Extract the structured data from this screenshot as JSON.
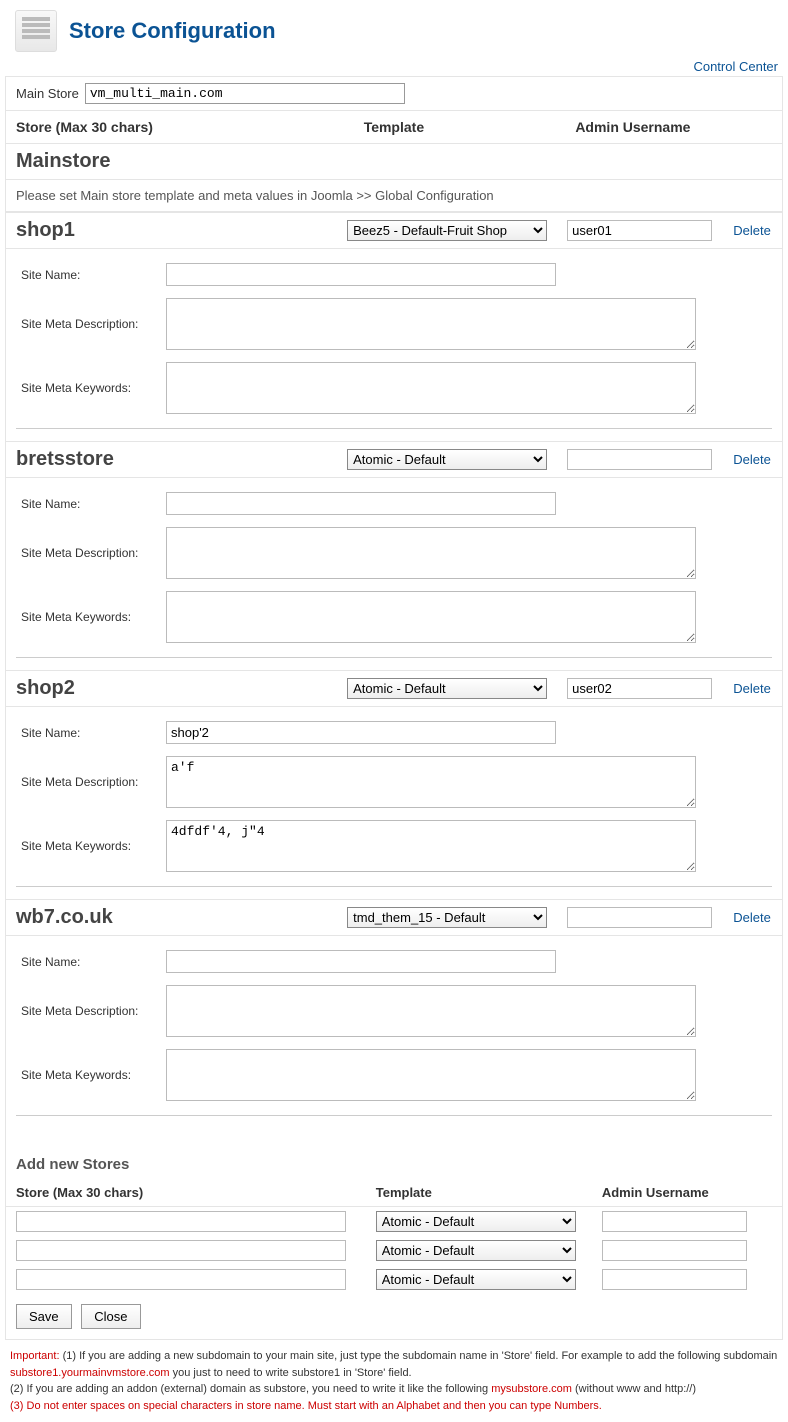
{
  "page_title": "Store Configuration",
  "control_center_link": "Control Center",
  "main_store_label": "Main Store",
  "main_store_value": "vm_multi_main.com",
  "columns": {
    "store": "Store (Max 30 chars)",
    "template": "Template",
    "admin": "Admin Username"
  },
  "mainstore_name": "Mainstore",
  "mainstore_info": "Please set Main store template and meta values in Joomla >> Global Configuration",
  "labels": {
    "site_name": "Site Name:",
    "site_meta_desc": "Site Meta Description:",
    "site_meta_keywords": "Site Meta Keywords:",
    "delete": "Delete"
  },
  "template_options": [
    "Beez5 - Default-Fruit Shop",
    "Atomic - Default",
    "tmd_them_15 - Default"
  ],
  "stores": [
    {
      "name": "shop1",
      "template": "Beez5 - Default-Fruit Shop",
      "admin": "user01",
      "site_name": "",
      "meta_desc": "",
      "meta_keywords": ""
    },
    {
      "name": "bretsstore",
      "template": "Atomic - Default",
      "admin": "",
      "site_name": "",
      "meta_desc": "",
      "meta_keywords": ""
    },
    {
      "name": "shop2",
      "template": "Atomic - Default",
      "admin": "user02",
      "site_name": "shop'2",
      "meta_desc": "a'f",
      "meta_keywords": "4dfdf'4, j\"4"
    },
    {
      "name": "wb7.co.uk",
      "template": "tmd_them_15 - Default",
      "admin": "",
      "site_name": "",
      "meta_desc": "",
      "meta_keywords": ""
    }
  ],
  "add_section_title": "Add new Stores",
  "add_rows": [
    {
      "store": "",
      "template": "Atomic - Default",
      "admin": ""
    },
    {
      "store": "",
      "template": "Atomic - Default",
      "admin": ""
    },
    {
      "store": "",
      "template": "Atomic - Default",
      "admin": ""
    }
  ],
  "buttons": {
    "save": "Save",
    "close": "Close"
  },
  "footnote": {
    "important": "Important:",
    "line1a": " (1) If you are adding a new subdomain to your main site, just type the subdomain name in 'Store' field. For example to add the following subdomain ",
    "substore": "substore1.yourmainvmstore.com",
    "line1b": " you just to need to write substore1 in 'Store' field.",
    "line2a": "(2) If you are adding an addon (external) domain as substore, you need to write it like the following ",
    "mysub": "mysubstore.com",
    "line2b": " (without www and http://)",
    "line3": "(3) Do not enter spaces on special characters in store name. Must start with an Alphabet and then you can type Numbers."
  }
}
